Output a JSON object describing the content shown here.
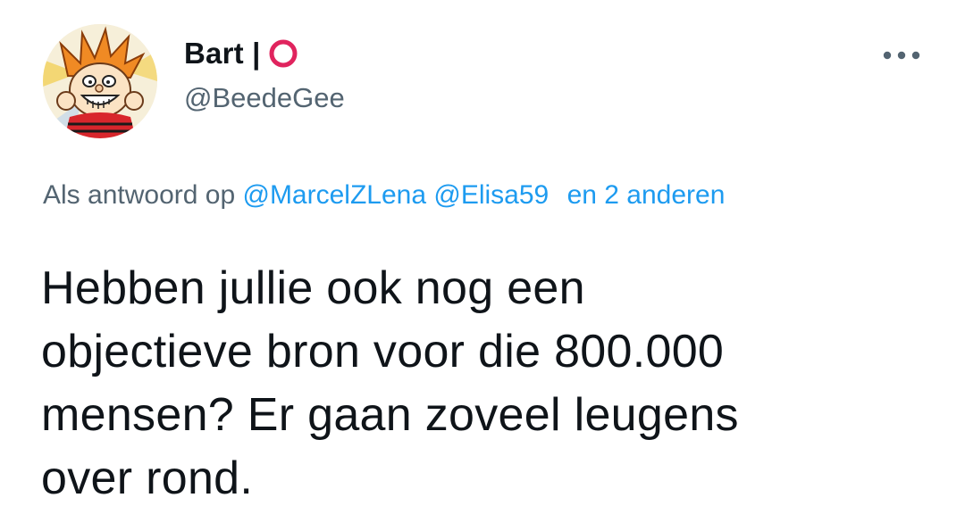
{
  "tweet": {
    "author": {
      "display_name": "Bart |",
      "handle": "@BeedeGee",
      "avatar_icon": "cartoon-boy-avatar",
      "badge_icon": "red-ring-icon",
      "badge_color": "#e0245e"
    },
    "more_icon": "more-dots-icon",
    "reply_context": {
      "prefix": "Als antwoord op",
      "mentions": [
        "@MarcelZLena",
        "@Elisa59"
      ],
      "others": "en 2 anderen"
    },
    "text": "Hebben jullie ook nog een\nobjectieve bron voor die 800.000\nmensen? Er gaan zoveel leugens\nover rond."
  },
  "colors": {
    "text_primary": "#0f1419",
    "text_secondary": "#536471",
    "link": "#1d9bf0"
  }
}
